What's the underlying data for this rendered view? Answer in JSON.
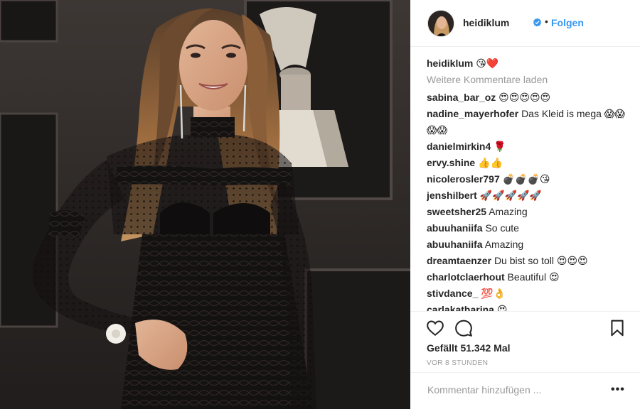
{
  "post": {
    "image_alt": "Frau im schwarzen Spitzenkleid vor Grammy-Wand"
  },
  "header": {
    "avatar_icon": "profile-avatar-icon",
    "username": "heidiklum",
    "verified_icon": "verified-badge-icon",
    "separator": "•",
    "follow_label": "Folgen"
  },
  "caption": {
    "username": "heidiklum",
    "text": "😘❤️"
  },
  "load_more_label": "Weitere Kommentare laden",
  "comments": [
    {
      "user": "sabina_bar_oz",
      "text": "😍😍😍😍😍"
    },
    {
      "user": "nadine_mayerhofer",
      "text": "Das Kleid is mega 😱😱😱😱"
    },
    {
      "user": "danielmirkin4",
      "text": "🌹"
    },
    {
      "user": "ervy.shine",
      "text": "👍👍"
    },
    {
      "user": "nicolerosler797",
      "text": "💣💣💣😘"
    },
    {
      "user": "jenshilbert",
      "text": "🚀🚀🚀🚀🚀"
    },
    {
      "user": "sweetsher25",
      "text": "Amazing"
    },
    {
      "user": "abuuhaniifa",
      "text": "So cute"
    },
    {
      "user": "abuuhaniifa",
      "text": "Amazing"
    },
    {
      "user": "dreamtaenzer",
      "text": "Du bist so toll 😍😍😍"
    },
    {
      "user": "charlotclaerhout",
      "text": "Beautiful 😍"
    },
    {
      "user": "stivdance_",
      "text": "💯👌"
    },
    {
      "user": "carlakatharina",
      "text": "😍"
    }
  ],
  "actions": {
    "like_icon": "heart-icon",
    "comment_icon": "comment-icon",
    "save_icon": "bookmark-icon",
    "likes_text": "Gefällt 51.342 Mal",
    "time_text": "VOR 8 STUNDEN"
  },
  "add_comment": {
    "placeholder": "Kommentar hinzufügen ...",
    "more_label": "•••"
  },
  "colors": {
    "link_blue": "#3897f0",
    "text": "#262626",
    "muted": "#999999",
    "border": "#efefef"
  }
}
